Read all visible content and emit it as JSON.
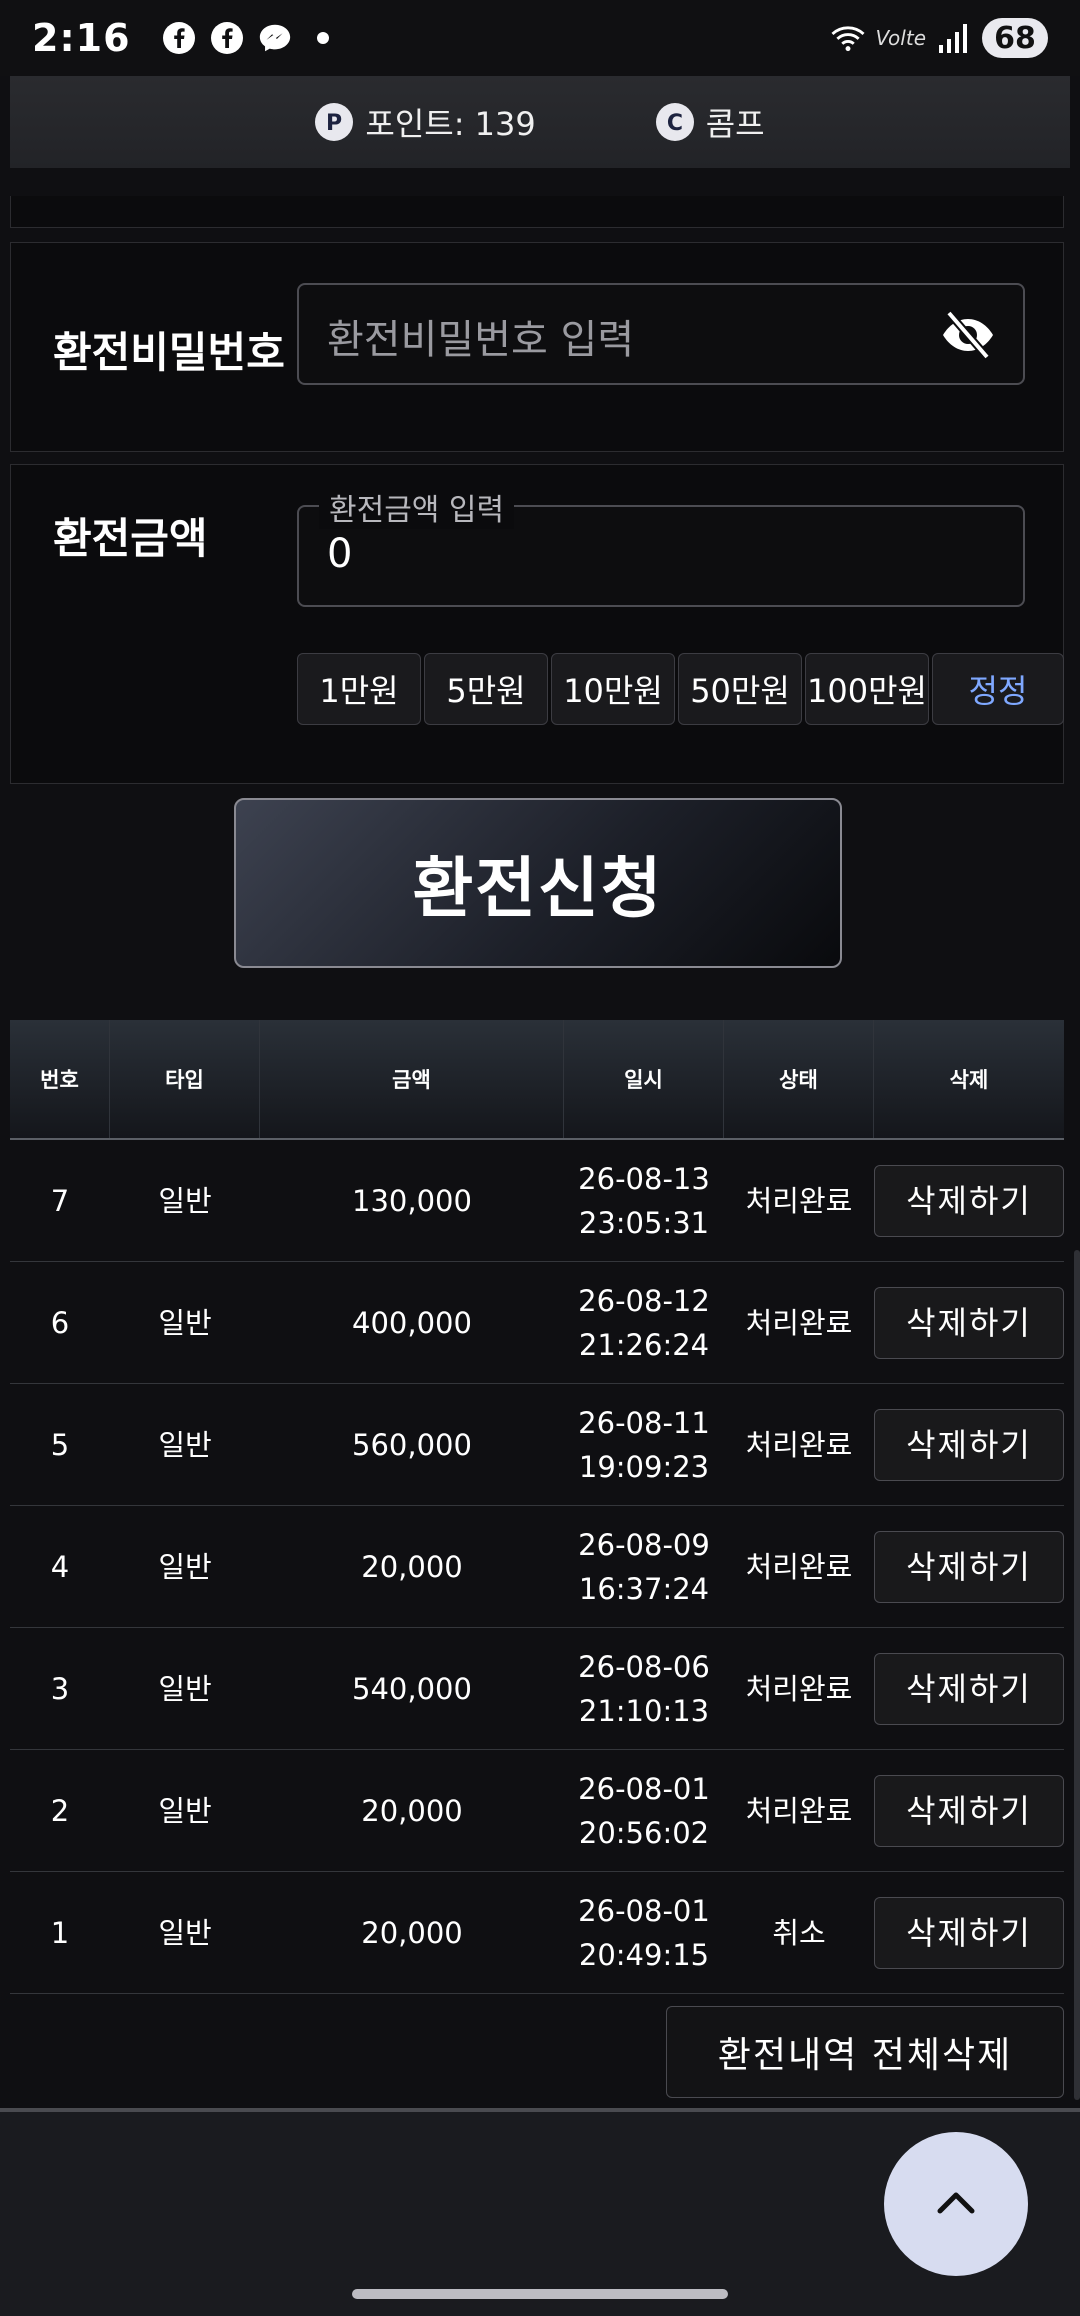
{
  "status_bar": {
    "time": "2:16",
    "volte": "Volte",
    "battery": "68"
  },
  "header": {
    "points_label": "포인트: 139",
    "comp_label": "콤프"
  },
  "password_form": {
    "label": "환전비밀번호",
    "placeholder": "환전비밀번호 입력"
  },
  "amount_form": {
    "label": "환전금액",
    "field_label": "환전금액 입력",
    "value": "0",
    "quick_buttons": [
      "1만원",
      "5만원",
      "10만원",
      "50만원",
      "100만원"
    ],
    "reset_label": "정정"
  },
  "submit_label": "환전신청",
  "table": {
    "headers": [
      "번호",
      "타입",
      "금액",
      "일시",
      "상태",
      "삭제"
    ],
    "rows": [
      {
        "no": "7",
        "type": "일반",
        "amount": "130,000",
        "date": "26-08-13",
        "time": "23:05:31",
        "status": "처리완료",
        "action": "삭제하기"
      },
      {
        "no": "6",
        "type": "일반",
        "amount": "400,000",
        "date": "26-08-12",
        "time": "21:26:24",
        "status": "처리완료",
        "action": "삭제하기"
      },
      {
        "no": "5",
        "type": "일반",
        "amount": "560,000",
        "date": "26-08-11",
        "time": "19:09:23",
        "status": "처리완료",
        "action": "삭제하기"
      },
      {
        "no": "4",
        "type": "일반",
        "amount": "20,000",
        "date": "26-08-09",
        "time": "16:37:24",
        "status": "처리완료",
        "action": "삭제하기"
      },
      {
        "no": "3",
        "type": "일반",
        "amount": "540,000",
        "date": "26-08-06",
        "time": "21:10:13",
        "status": "처리완료",
        "action": "삭제하기"
      },
      {
        "no": "2",
        "type": "일반",
        "amount": "20,000",
        "date": "26-08-01",
        "time": "20:56:02",
        "status": "처리완료",
        "action": "삭제하기"
      },
      {
        "no": "1",
        "type": "일반",
        "amount": "20,000",
        "date": "26-08-01",
        "time": "20:49:15",
        "status": "취소",
        "action": "삭제하기"
      }
    ]
  },
  "delete_all_label": "환전내역 전체삭제",
  "icons": {
    "points": "p-badge-icon",
    "comp": "c-badge-icon",
    "password_toggle": "eye-off-icon",
    "scroll_top": "chevron-up-icon"
  },
  "colors": {
    "reset_text": "#7fa8ff",
    "fab_bg": "#d7dcf0"
  }
}
